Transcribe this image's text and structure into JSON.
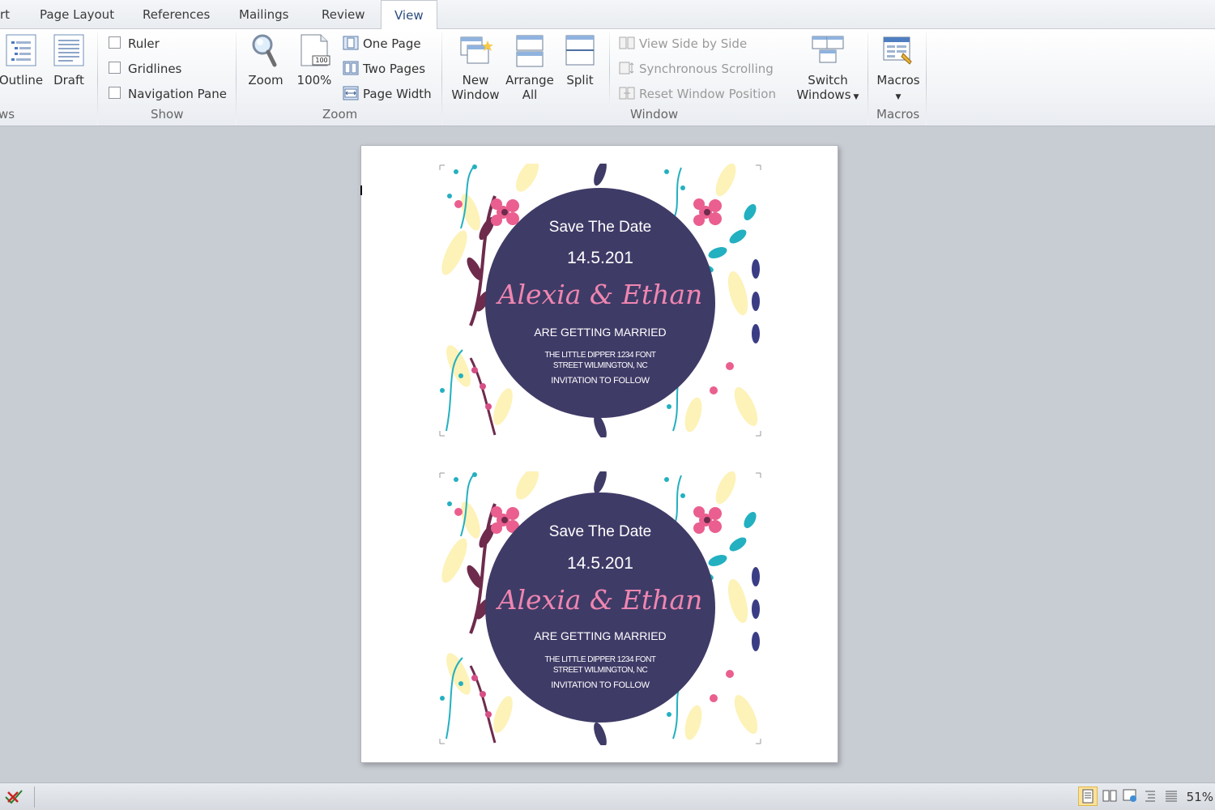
{
  "tabs": [
    {
      "label": "rt"
    },
    {
      "label": "Page Layout"
    },
    {
      "label": "References"
    },
    {
      "label": "Mailings"
    },
    {
      "label": "Review"
    },
    {
      "label": "View",
      "active": true
    }
  ],
  "ribbon": {
    "views": {
      "group_label": "ws",
      "outline": "Outline",
      "draft": "Draft"
    },
    "show": {
      "group_label": "Show",
      "ruler": "Ruler",
      "gridlines": "Gridlines",
      "navigation_pane": "Navigation Pane"
    },
    "zoom": {
      "group_label": "Zoom",
      "zoom": "Zoom",
      "hundred": "100%",
      "hundred_badge": "100",
      "one_page": "One Page",
      "two_pages": "Two Pages",
      "page_width": "Page Width"
    },
    "window": {
      "group_label": "Window",
      "new_window_1": "New",
      "new_window_2": "Window",
      "arrange_all_1": "Arrange",
      "arrange_all_2": "All",
      "split": "Split",
      "view_side_by_side": "View Side by Side",
      "synchronous_scrolling": "Synchronous Scrolling",
      "reset_window_position": "Reset Window Position",
      "switch_windows_1": "Switch",
      "switch_windows_2": "Windows"
    },
    "macros": {
      "group_label": "Macros",
      "macros": "Macros"
    }
  },
  "document": {
    "cards": [
      {
        "title": "Save The Date",
        "date": "14.5.201",
        "names": "Alexia & Ethan",
        "announcement": "ARE GETTING MARRIED",
        "address_line1": "THE LITTLE DIPPER 1234 FONT",
        "address_line2": "STREET WILMINGTON, NC",
        "note": "INVITATION TO FOLLOW"
      },
      {
        "title": "Save The Date",
        "date": "14.5.201",
        "names": "Alexia & Ethan",
        "announcement": "ARE GETTING MARRIED",
        "address_line1": "THE LITTLE DIPPER 1234 FONT",
        "address_line2": "STREET WILMINGTON, NC",
        "note": "INVITATION TO FOLLOW"
      }
    ]
  },
  "status_bar": {
    "zoom_level": "51%"
  },
  "colors": {
    "circle": "#3f3b67",
    "names_pink": "#ef86b0",
    "teal": "#23b0c0",
    "pink": "#ea5f8f",
    "plum": "#6e2b4c",
    "cream": "#fdf2b8",
    "navy": "#3a3d84"
  }
}
